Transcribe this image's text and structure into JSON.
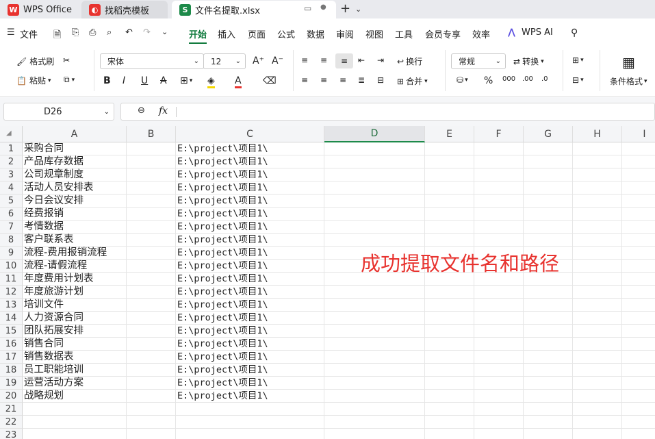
{
  "tabs": {
    "wps": "WPS Office",
    "template": "找稻壳模板",
    "file": "文件名提取.xlsx"
  },
  "menu": {
    "file": "文件",
    "items": [
      "开始",
      "插入",
      "页面",
      "公式",
      "数据",
      "审阅",
      "视图",
      "工具",
      "会员专享",
      "效率"
    ],
    "ai": "WPS AI"
  },
  "ribbon": {
    "format_painter": "格式刷",
    "paste": "粘贴",
    "font": "宋体",
    "size": "12",
    "wrap": "换行",
    "number_format": "常规",
    "convert": "转换",
    "merge": "合并",
    "conditional": "条件格式"
  },
  "formula_bar": {
    "name_box": "D26",
    "fx": "fx"
  },
  "columns": [
    "A",
    "B",
    "C",
    "D",
    "E",
    "F",
    "G",
    "H",
    "I"
  ],
  "rows": [
    "1",
    "2",
    "3",
    "4",
    "5",
    "6",
    "7",
    "8",
    "9",
    "10",
    "11",
    "12",
    "13",
    "14",
    "15",
    "16",
    "17",
    "18",
    "19",
    "20",
    "21",
    "22",
    "23"
  ],
  "col_a": [
    "采购合同",
    "产品库存数据",
    "公司规章制度",
    "活动人员安排表",
    "今日会议安排",
    "经费报销",
    "考情数据",
    "客户联系表",
    "流程-费用报销流程",
    "流程-请假流程",
    "年度费用计划表",
    "年度旅游计划",
    "培训文件",
    "人力资源合同",
    "团队拓展安排",
    "销售合同",
    "销售数据表",
    "员工职能培训",
    "运营活动方案",
    "战略规划"
  ],
  "col_c": [
    "E:\\project\\项目1\\",
    "E:\\project\\项目1\\",
    "E:\\project\\项目1\\",
    "E:\\project\\项目1\\",
    "E:\\project\\项目1\\",
    "E:\\project\\项目1\\",
    "E:\\project\\项目1\\",
    "E:\\project\\项目1\\",
    "E:\\project\\项目1\\",
    "E:\\project\\项目1\\",
    "E:\\project\\项目1\\",
    "E:\\project\\项目1\\",
    "E:\\project\\项目1\\",
    "E:\\project\\项目1\\",
    "E:\\project\\项目1\\",
    "E:\\project\\项目1\\",
    "E:\\project\\项目1\\",
    "E:\\project\\项目1\\",
    "E:\\project\\项目1\\",
    "E:\\project\\项目1\\"
  ],
  "overlay_text": "成功提取文件名和路径"
}
